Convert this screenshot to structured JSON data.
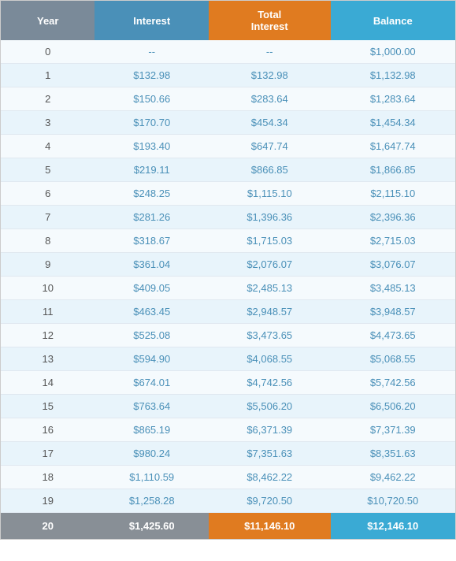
{
  "table": {
    "headers": [
      "Year",
      "Interest",
      "Total Interest",
      "Balance"
    ],
    "rows": [
      {
        "year": "0",
        "interest": "--",
        "total_interest": "--",
        "balance": "$1,000.00"
      },
      {
        "year": "1",
        "interest": "$132.98",
        "total_interest": "$132.98",
        "balance": "$1,132.98"
      },
      {
        "year": "2",
        "interest": "$150.66",
        "total_interest": "$283.64",
        "balance": "$1,283.64"
      },
      {
        "year": "3",
        "interest": "$170.70",
        "total_interest": "$454.34",
        "balance": "$1,454.34"
      },
      {
        "year": "4",
        "interest": "$193.40",
        "total_interest": "$647.74",
        "balance": "$1,647.74"
      },
      {
        "year": "5",
        "interest": "$219.11",
        "total_interest": "$866.85",
        "balance": "$1,866.85"
      },
      {
        "year": "6",
        "interest": "$248.25",
        "total_interest": "$1,115.10",
        "balance": "$2,115.10"
      },
      {
        "year": "7",
        "interest": "$281.26",
        "total_interest": "$1,396.36",
        "balance": "$2,396.36"
      },
      {
        "year": "8",
        "interest": "$318.67",
        "total_interest": "$1,715.03",
        "balance": "$2,715.03"
      },
      {
        "year": "9",
        "interest": "$361.04",
        "total_interest": "$2,076.07",
        "balance": "$3,076.07"
      },
      {
        "year": "10",
        "interest": "$409.05",
        "total_interest": "$2,485.13",
        "balance": "$3,485.13"
      },
      {
        "year": "11",
        "interest": "$463.45",
        "total_interest": "$2,948.57",
        "balance": "$3,948.57"
      },
      {
        "year": "12",
        "interest": "$525.08",
        "total_interest": "$3,473.65",
        "balance": "$4,473.65"
      },
      {
        "year": "13",
        "interest": "$594.90",
        "total_interest": "$4,068.55",
        "balance": "$5,068.55"
      },
      {
        "year": "14",
        "interest": "$674.01",
        "total_interest": "$4,742.56",
        "balance": "$5,742.56"
      },
      {
        "year": "15",
        "interest": "$763.64",
        "total_interest": "$5,506.20",
        "balance": "$6,506.20"
      },
      {
        "year": "16",
        "interest": "$865.19",
        "total_interest": "$6,371.39",
        "balance": "$7,371.39"
      },
      {
        "year": "17",
        "interest": "$980.24",
        "total_interest": "$7,351.63",
        "balance": "$8,351.63"
      },
      {
        "year": "18",
        "interest": "$1,110.59",
        "total_interest": "$8,462.22",
        "balance": "$9,462.22"
      },
      {
        "year": "19",
        "interest": "$1,258.28",
        "total_interest": "$9,720.50",
        "balance": "$10,720.50"
      }
    ],
    "footer": {
      "year": "20",
      "interest": "$1,425.60",
      "total_interest": "$11,146.10",
      "balance": "$12,146.10"
    }
  }
}
